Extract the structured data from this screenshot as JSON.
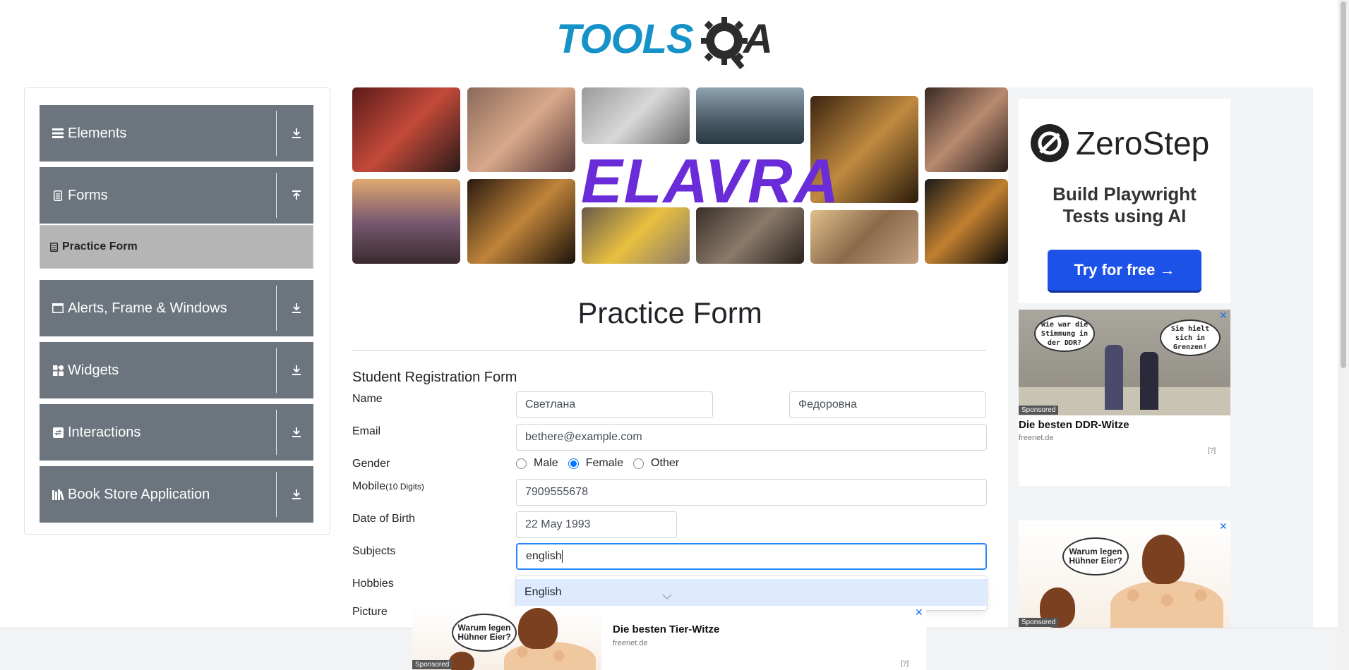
{
  "logo": {
    "part1": "TOOLS",
    "part2": "A",
    "gear_icon": "gear-magnifier-icon"
  },
  "sidebar": {
    "groups": [
      {
        "label": "Elements",
        "icon": "list-icon",
        "arrow": "download-arrow-icon"
      },
      {
        "label": "Forms",
        "icon": "document-icon",
        "arrow": "upload-arrow-icon"
      },
      {
        "label": "Alerts, Frame & Windows",
        "icon": "window-icon",
        "arrow": "download-arrow-icon"
      },
      {
        "label": "Widgets",
        "icon": "widgets-icon",
        "arrow": "download-arrow-icon"
      },
      {
        "label": "Interactions",
        "icon": "interactions-icon",
        "arrow": "download-arrow-icon"
      },
      {
        "label": "Book Store Application",
        "icon": "books-icon",
        "arrow": "download-arrow-icon"
      }
    ],
    "active_item": {
      "label": "Practice Form",
      "icon": "form-icon"
    }
  },
  "banner": {
    "text": "ELAVRA"
  },
  "form": {
    "title": "Practice Form",
    "heading": "Student Registration Form",
    "labels": {
      "name": "Name",
      "email": "Email",
      "gender": "Gender",
      "mobile": "Mobile",
      "mobile_hint": "(10 Digits)",
      "dob": "Date of Birth",
      "subjects": "Subjects",
      "hobbies": "Hobbies",
      "picture": "Picture"
    },
    "values": {
      "first_name": "Светлана",
      "last_name": "Федоровна",
      "email": "bethere@example.com",
      "mobile": "7909555678",
      "dob": "22 May 1993",
      "subjects_input": "english"
    },
    "gender_options": [
      "Male",
      "Female",
      "Other"
    ],
    "gender_selected": "Female",
    "subject_suggestion": "English"
  },
  "ads": {
    "zerostep": {
      "name": "ZeroStep",
      "tagline_1": "Build Playwright",
      "tagline_2": "Tests using AI",
      "button": "Try for free →"
    },
    "ad1": {
      "bubble_1": "Wie war die Stimmung in der DDR?",
      "bubble_2": "Sie hielt sich in Grenzen!",
      "sponsored": "Sponsored",
      "title": "Die besten DDR-Witze",
      "domain": "freenet.de",
      "info": "[?]"
    },
    "ad2": {
      "bubble": "Warum legen Hühner Eier?",
      "sponsored": "Sponsored"
    },
    "ad_bottom": {
      "bubble": "Warum legen Hühner Eier?",
      "sponsored": "Sponsored",
      "title": "Die besten Tier-Witze",
      "domain": "freenet.de",
      "info": "[?]"
    },
    "close_symbol": "✕"
  }
}
